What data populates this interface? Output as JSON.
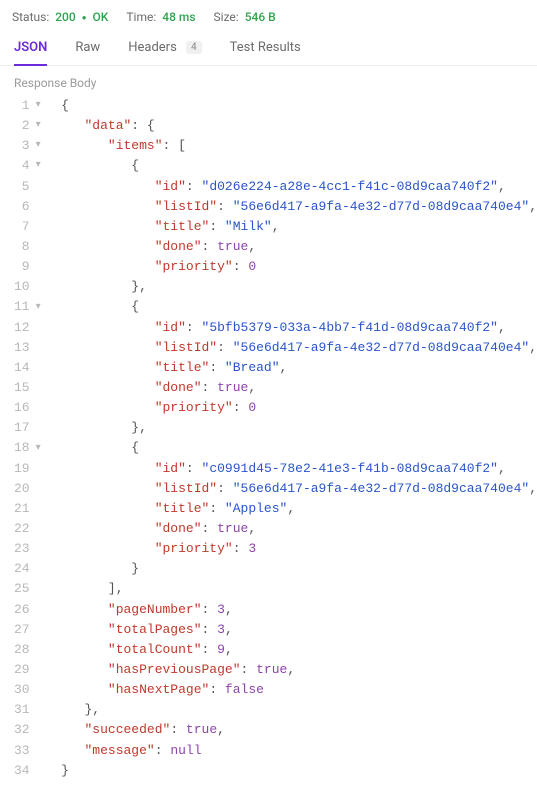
{
  "status": {
    "label": "Status:",
    "code": "200",
    "ok": "OK",
    "time_label": "Time:",
    "time_value": "48 ms",
    "size_label": "Size:",
    "size_value": "546 B"
  },
  "tabs": {
    "json": "JSON",
    "raw": "Raw",
    "headers": "Headers",
    "headers_badge": "4",
    "test_results": "Test Results"
  },
  "section_label": "Response Body",
  "code_lines": [
    {
      "n": 1,
      "fold": "▾",
      "indent": 0,
      "tokens": [
        {
          "t": "{",
          "c": "p"
        }
      ]
    },
    {
      "n": 2,
      "fold": "▾",
      "indent": 1,
      "tokens": [
        {
          "t": "\"data\"",
          "c": "k"
        },
        {
          "t": ": ",
          "c": "p"
        },
        {
          "t": "{",
          "c": "p"
        }
      ]
    },
    {
      "n": 3,
      "fold": "▾",
      "indent": 2,
      "tokens": [
        {
          "t": "\"items\"",
          "c": "k"
        },
        {
          "t": ": ",
          "c": "p"
        },
        {
          "t": "[",
          "c": "p"
        }
      ]
    },
    {
      "n": 4,
      "fold": "▾",
      "indent": 3,
      "tokens": [
        {
          "t": "{",
          "c": "p"
        }
      ]
    },
    {
      "n": 5,
      "fold": "",
      "indent": 4,
      "tokens": [
        {
          "t": "\"id\"",
          "c": "k"
        },
        {
          "t": ": ",
          "c": "p"
        },
        {
          "t": "\"d026e224-a28e-4cc1-f41c-08d9caa740f2\"",
          "c": "s"
        },
        {
          "t": ",",
          "c": "p"
        }
      ]
    },
    {
      "n": 6,
      "fold": "",
      "indent": 4,
      "tokens": [
        {
          "t": "\"listId\"",
          "c": "k"
        },
        {
          "t": ": ",
          "c": "p"
        },
        {
          "t": "\"56e6d417-a9fa-4e32-d77d-08d9caa740e4\"",
          "c": "s"
        },
        {
          "t": ",",
          "c": "p"
        }
      ]
    },
    {
      "n": 7,
      "fold": "",
      "indent": 4,
      "tokens": [
        {
          "t": "\"title\"",
          "c": "k"
        },
        {
          "t": ": ",
          "c": "p"
        },
        {
          "t": "\"Milk\"",
          "c": "s"
        },
        {
          "t": ",",
          "c": "p"
        }
      ]
    },
    {
      "n": 8,
      "fold": "",
      "indent": 4,
      "tokens": [
        {
          "t": "\"done\"",
          "c": "k"
        },
        {
          "t": ": ",
          "c": "p"
        },
        {
          "t": "true",
          "c": "n"
        },
        {
          "t": ",",
          "c": "p"
        }
      ]
    },
    {
      "n": 9,
      "fold": "",
      "indent": 4,
      "tokens": [
        {
          "t": "\"priority\"",
          "c": "k"
        },
        {
          "t": ": ",
          "c": "p"
        },
        {
          "t": "0",
          "c": "n"
        }
      ]
    },
    {
      "n": 10,
      "fold": "",
      "indent": 3,
      "tokens": [
        {
          "t": "},",
          "c": "p"
        }
      ]
    },
    {
      "n": 11,
      "fold": "▾",
      "indent": 3,
      "tokens": [
        {
          "t": "{",
          "c": "p"
        }
      ]
    },
    {
      "n": 12,
      "fold": "",
      "indent": 4,
      "tokens": [
        {
          "t": "\"id\"",
          "c": "k"
        },
        {
          "t": ": ",
          "c": "p"
        },
        {
          "t": "\"5bfb5379-033a-4bb7-f41d-08d9caa740f2\"",
          "c": "s"
        },
        {
          "t": ",",
          "c": "p"
        }
      ]
    },
    {
      "n": 13,
      "fold": "",
      "indent": 4,
      "tokens": [
        {
          "t": "\"listId\"",
          "c": "k"
        },
        {
          "t": ": ",
          "c": "p"
        },
        {
          "t": "\"56e6d417-a9fa-4e32-d77d-08d9caa740e4\"",
          "c": "s"
        },
        {
          "t": ",",
          "c": "p"
        }
      ]
    },
    {
      "n": 14,
      "fold": "",
      "indent": 4,
      "tokens": [
        {
          "t": "\"title\"",
          "c": "k"
        },
        {
          "t": ": ",
          "c": "p"
        },
        {
          "t": "\"Bread\"",
          "c": "s"
        },
        {
          "t": ",",
          "c": "p"
        }
      ]
    },
    {
      "n": 15,
      "fold": "",
      "indent": 4,
      "tokens": [
        {
          "t": "\"done\"",
          "c": "k"
        },
        {
          "t": ": ",
          "c": "p"
        },
        {
          "t": "true",
          "c": "n"
        },
        {
          "t": ",",
          "c": "p"
        }
      ]
    },
    {
      "n": 16,
      "fold": "",
      "indent": 4,
      "tokens": [
        {
          "t": "\"priority\"",
          "c": "k"
        },
        {
          "t": ": ",
          "c": "p"
        },
        {
          "t": "0",
          "c": "n"
        }
      ]
    },
    {
      "n": 17,
      "fold": "",
      "indent": 3,
      "tokens": [
        {
          "t": "},",
          "c": "p"
        }
      ]
    },
    {
      "n": 18,
      "fold": "▾",
      "indent": 3,
      "tokens": [
        {
          "t": "{",
          "c": "p"
        }
      ]
    },
    {
      "n": 19,
      "fold": "",
      "indent": 4,
      "tokens": [
        {
          "t": "\"id\"",
          "c": "k"
        },
        {
          "t": ": ",
          "c": "p"
        },
        {
          "t": "\"c0991d45-78e2-41e3-f41b-08d9caa740f2\"",
          "c": "s"
        },
        {
          "t": ",",
          "c": "p"
        }
      ]
    },
    {
      "n": 20,
      "fold": "",
      "indent": 4,
      "tokens": [
        {
          "t": "\"listId\"",
          "c": "k"
        },
        {
          "t": ": ",
          "c": "p"
        },
        {
          "t": "\"56e6d417-a9fa-4e32-d77d-08d9caa740e4\"",
          "c": "s"
        },
        {
          "t": ",",
          "c": "p"
        }
      ]
    },
    {
      "n": 21,
      "fold": "",
      "indent": 4,
      "tokens": [
        {
          "t": "\"title\"",
          "c": "k"
        },
        {
          "t": ": ",
          "c": "p"
        },
        {
          "t": "\"Apples\"",
          "c": "s"
        },
        {
          "t": ",",
          "c": "p"
        }
      ]
    },
    {
      "n": 22,
      "fold": "",
      "indent": 4,
      "tokens": [
        {
          "t": "\"done\"",
          "c": "k"
        },
        {
          "t": ": ",
          "c": "p"
        },
        {
          "t": "true",
          "c": "n"
        },
        {
          "t": ",",
          "c": "p"
        }
      ]
    },
    {
      "n": 23,
      "fold": "",
      "indent": 4,
      "tokens": [
        {
          "t": "\"priority\"",
          "c": "k"
        },
        {
          "t": ": ",
          "c": "p"
        },
        {
          "t": "3",
          "c": "n"
        }
      ]
    },
    {
      "n": 24,
      "fold": "",
      "indent": 3,
      "tokens": [
        {
          "t": "}",
          "c": "p"
        }
      ]
    },
    {
      "n": 25,
      "fold": "",
      "indent": 2,
      "tokens": [
        {
          "t": "],",
          "c": "p"
        }
      ]
    },
    {
      "n": 26,
      "fold": "",
      "indent": 2,
      "tokens": [
        {
          "t": "\"pageNumber\"",
          "c": "k"
        },
        {
          "t": ": ",
          "c": "p"
        },
        {
          "t": "3",
          "c": "n"
        },
        {
          "t": ",",
          "c": "p"
        }
      ]
    },
    {
      "n": 27,
      "fold": "",
      "indent": 2,
      "tokens": [
        {
          "t": "\"totalPages\"",
          "c": "k"
        },
        {
          "t": ": ",
          "c": "p"
        },
        {
          "t": "3",
          "c": "n"
        },
        {
          "t": ",",
          "c": "p"
        }
      ]
    },
    {
      "n": 28,
      "fold": "",
      "indent": 2,
      "tokens": [
        {
          "t": "\"totalCount\"",
          "c": "k"
        },
        {
          "t": ": ",
          "c": "p"
        },
        {
          "t": "9",
          "c": "n"
        },
        {
          "t": ",",
          "c": "p"
        }
      ]
    },
    {
      "n": 29,
      "fold": "",
      "indent": 2,
      "tokens": [
        {
          "t": "\"hasPreviousPage\"",
          "c": "k"
        },
        {
          "t": ": ",
          "c": "p"
        },
        {
          "t": "true",
          "c": "n"
        },
        {
          "t": ",",
          "c": "p"
        }
      ]
    },
    {
      "n": 30,
      "fold": "",
      "indent": 2,
      "tokens": [
        {
          "t": "\"hasNextPage\"",
          "c": "k"
        },
        {
          "t": ": ",
          "c": "p"
        },
        {
          "t": "false",
          "c": "n"
        }
      ]
    },
    {
      "n": 31,
      "fold": "",
      "indent": 1,
      "tokens": [
        {
          "t": "},",
          "c": "p"
        }
      ]
    },
    {
      "n": 32,
      "fold": "",
      "indent": 1,
      "tokens": [
        {
          "t": "\"succeeded\"",
          "c": "k"
        },
        {
          "t": ": ",
          "c": "p"
        },
        {
          "t": "true",
          "c": "n"
        },
        {
          "t": ",",
          "c": "p"
        }
      ]
    },
    {
      "n": 33,
      "fold": "",
      "indent": 1,
      "tokens": [
        {
          "t": "\"message\"",
          "c": "k"
        },
        {
          "t": ": ",
          "c": "p"
        },
        {
          "t": "null",
          "c": "n"
        }
      ]
    },
    {
      "n": 34,
      "fold": "",
      "indent": 0,
      "tokens": [
        {
          "t": "}",
          "c": "p"
        }
      ]
    }
  ]
}
